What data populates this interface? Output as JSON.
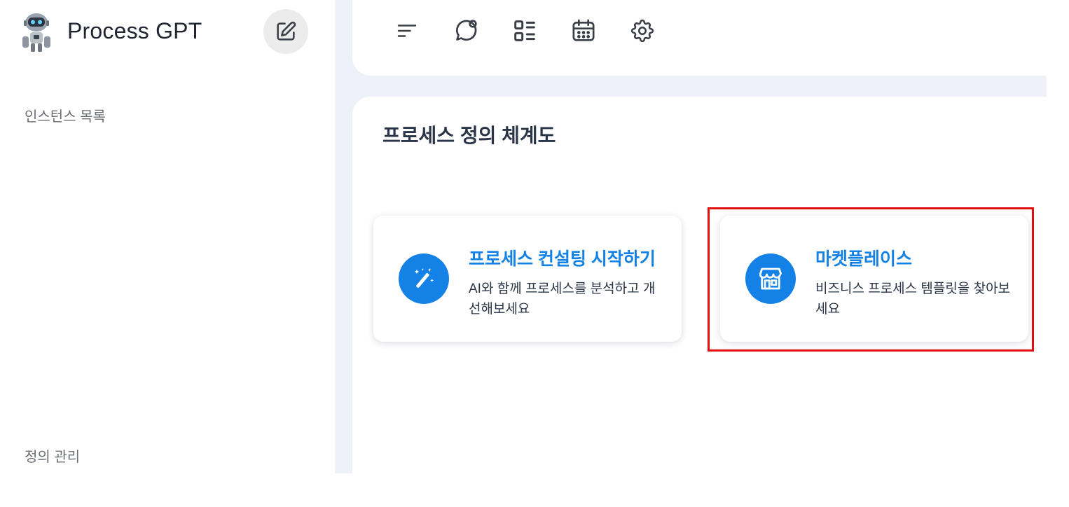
{
  "app": {
    "name": "Process GPT"
  },
  "sidebar": {
    "instances_label": "인스턴스 목록",
    "definitions_label": "정의 관리"
  },
  "toolbar": {
    "icons": [
      "menu-lines-icon",
      "chat-bubble-icon",
      "list-grid-icon",
      "calendar-icon",
      "gear-icon"
    ]
  },
  "main": {
    "title": "프로세스 정의 체계도",
    "cards": [
      {
        "title": "프로세스 컨설팅 시작하기",
        "description": "AI와 함께 프로세스를 분석하고 개선해보세요",
        "icon": "magic-wand-icon"
      },
      {
        "title": "마켓플레이스",
        "description": "비즈니스 프로세스 템플릿을 찾아보세요",
        "icon": "storefront-icon"
      }
    ]
  },
  "colors": {
    "accent": "#1381e6",
    "highlight": "#e01010",
    "background": "#eef2f8"
  }
}
